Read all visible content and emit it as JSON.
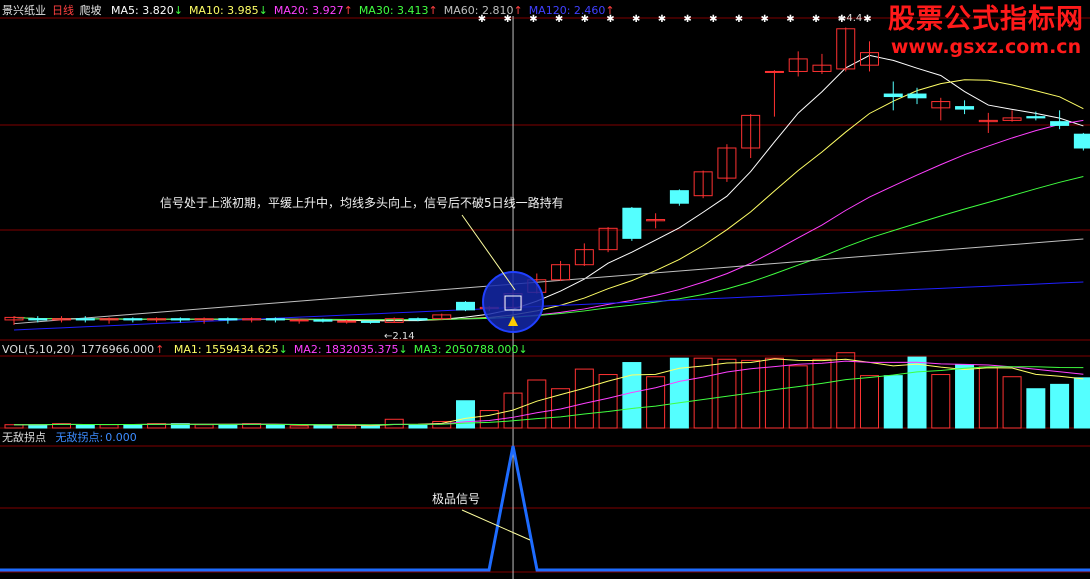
{
  "header": {
    "stock_name": "景兴纸业",
    "period": "日线",
    "strategy": "爬坡",
    "ma_items": [
      {
        "label": "MA5:",
        "value": "3.820",
        "arrow": "↓",
        "color": "#ffffff"
      },
      {
        "label": "MA10:",
        "value": "3.985",
        "arrow": "↓",
        "color": "#ffff66"
      },
      {
        "label": "MA20:",
        "value": "3.927",
        "arrow": "↑",
        "color": "#ff40ff"
      },
      {
        "label": "MA30:",
        "value": "3.413",
        "arrow": "↑",
        "color": "#40ff40"
      },
      {
        "label": "MA60:",
        "value": "2.810",
        "arrow": "↑",
        "color": "#c0c0c0"
      },
      {
        "label": "MA120:",
        "value": "2.460",
        "arrow": "↑",
        "color": "#4040ff"
      }
    ]
  },
  "vol_header": {
    "title": "VOL(5,10,20)",
    "value": "1776966.000",
    "arrow": "↑",
    "ma_items": [
      {
        "label": "MA1:",
        "value": "1559434.625",
        "arrow": "↓",
        "color": "#ffff66"
      },
      {
        "label": "MA2:",
        "value": "1832035.375",
        "arrow": "↓",
        "color": "#ff40ff"
      },
      {
        "label": "MA3:",
        "value": "2050788.000",
        "arrow": "↓",
        "color": "#40ff40"
      }
    ]
  },
  "ind_header": {
    "title": "无敌拐点",
    "series_label": "无敌拐点:",
    "value": "0.000"
  },
  "watermark": {
    "line1": "股票公式指标网",
    "line2": "www.gsxz.com.cn"
  },
  "annotations": {
    "main": "信号处于上涨初期，平缓上升中，均线多头向上，信号后不破5日线一路持有",
    "indicator": "极品信号",
    "low_price": "2.14",
    "high_price": "4.4"
  },
  "colors": {
    "up": "#ff3232",
    "down": "#54ffff",
    "ma5": "#ffffff",
    "ma10": "#ffff66",
    "ma20": "#ff40ff",
    "ma30": "#40ff40",
    "ma60": "#c0c0c0",
    "ma120": "#2020ff",
    "signal": "#1e6cff",
    "grid": "#800000",
    "crosshair": "#c0c0c0"
  },
  "chart_data": {
    "type": "candlestick",
    "price_range": [
      2.0,
      4.55
    ],
    "vol_range": [
      0,
      3300000
    ],
    "signal_index": 21,
    "candles": [
      [
        2.16,
        2.18,
        2.12,
        2.19
      ],
      [
        2.17,
        2.16,
        2.14,
        2.19
      ],
      [
        2.16,
        2.17,
        2.14,
        2.19
      ],
      [
        2.17,
        2.16,
        2.14,
        2.19
      ],
      [
        2.16,
        2.17,
        2.13,
        2.18
      ],
      [
        2.17,
        2.16,
        2.14,
        2.18
      ],
      [
        2.16,
        2.17,
        2.14,
        2.18
      ],
      [
        2.17,
        2.16,
        2.14,
        2.18
      ],
      [
        2.16,
        2.17,
        2.13,
        2.18
      ],
      [
        2.17,
        2.16,
        2.13,
        2.18
      ],
      [
        2.16,
        2.17,
        2.14,
        2.18
      ],
      [
        2.17,
        2.16,
        2.14,
        2.18
      ],
      [
        2.16,
        2.16,
        2.13,
        2.17
      ],
      [
        2.16,
        2.15,
        2.14,
        2.17
      ],
      [
        2.15,
        2.15,
        2.13,
        2.16
      ],
      [
        2.15,
        2.14,
        2.13,
        2.15
      ],
      [
        2.14,
        2.17,
        2.14,
        2.18
      ],
      [
        2.17,
        2.16,
        2.15,
        2.18
      ],
      [
        2.17,
        2.2,
        2.16,
        2.21
      ],
      [
        2.3,
        2.24,
        2.23,
        2.31
      ],
      [
        2.25,
        2.26,
        2.23,
        2.27
      ],
      [
        2.26,
        2.37,
        2.24,
        2.4
      ],
      [
        2.38,
        2.48,
        2.37,
        2.53
      ],
      [
        2.48,
        2.6,
        2.47,
        2.63
      ],
      [
        2.6,
        2.72,
        2.59,
        2.77
      ],
      [
        2.72,
        2.89,
        2.7,
        2.9
      ],
      [
        3.05,
        2.81,
        2.79,
        3.06
      ],
      [
        2.95,
        2.96,
        2.89,
        3.01
      ],
      [
        3.19,
        3.09,
        3.07,
        3.2
      ],
      [
        3.15,
        3.34,
        3.13,
        3.35
      ],
      [
        3.29,
        3.53,
        3.26,
        3.56
      ],
      [
        3.53,
        3.79,
        3.45,
        3.8
      ],
      [
        4.14,
        4.14,
        3.78,
        4.15
      ],
      [
        4.14,
        4.24,
        4.1,
        4.3
      ],
      [
        4.14,
        4.19,
        4.12,
        4.28
      ],
      [
        4.16,
        4.48,
        4.14,
        4.49
      ],
      [
        4.19,
        4.29,
        4.14,
        4.38
      ],
      [
        3.96,
        3.94,
        3.83,
        4.06
      ],
      [
        3.96,
        3.93,
        3.88,
        4.01
      ],
      [
        3.85,
        3.9,
        3.75,
        3.93
      ],
      [
        3.86,
        3.84,
        3.8,
        3.91
      ],
      [
        3.74,
        3.75,
        3.65,
        3.81
      ],
      [
        3.75,
        3.77,
        3.74,
        3.83
      ],
      [
        3.78,
        3.77,
        3.75,
        3.82
      ],
      [
        3.74,
        3.71,
        3.68,
        3.83
      ],
      [
        3.64,
        3.53,
        3.51,
        3.65
      ]
    ],
    "volume": [
      150000,
      150000,
      200000,
      150000,
      150000,
      150000,
      200000,
      200000,
      150000,
      150000,
      200000,
      150000,
      100000,
      100000,
      100000,
      100000,
      400000,
      150000,
      300000,
      1250000,
      800000,
      1600000,
      2200000,
      1800000,
      2700000,
      2450000,
      3000000,
      2350000,
      3200000,
      3200000,
      3150000,
      3100000,
      3200000,
      2850000,
      3150000,
      3450000,
      2400000,
      2400000,
      3250000,
      2450000,
      2900000,
      2800000,
      2350000,
      1800000,
      2000000,
      2300000
    ],
    "indicator": {
      "name": "无敌拐点",
      "peak_index": 21,
      "peak_value": 1,
      "base_value": 0
    }
  }
}
